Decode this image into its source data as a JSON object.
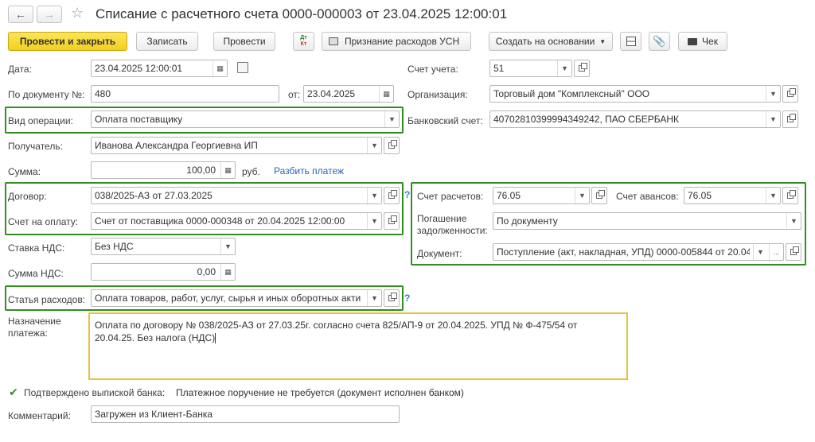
{
  "title": "Списание с расчетного счета 0000-000003 от 23.04.2025 12:00:01",
  "toolbar": {
    "post_close": "Провести и закрыть",
    "save": "Записать",
    "post": "Провести",
    "dtkt_top": "Дт",
    "dtkt_bottom": "Кт",
    "usn": "Признание расходов УСН",
    "create_based": "Создать на основании",
    "check": "Чек"
  },
  "fields": {
    "date_label": "Дата:",
    "date_value": "23.04.2025 12:00:01",
    "doc_no_label": "По документу №:",
    "doc_no_value": "480",
    "from_label": "от:",
    "from_value": "23.04.2025",
    "op_type_label": "Вид операции:",
    "op_type_value": "Оплата поставщику",
    "recipient_label": "Получатель:",
    "recipient_value": "Иванова Александра Георгиевна ИП",
    "sum_label": "Сумма:",
    "sum_value": "100,00",
    "currency": "руб.",
    "split_link": "Разбить платеж",
    "contract_label": "Договор:",
    "contract_value": "038/2025-АЗ от 27.03.2025",
    "invoice_label": "Счет на оплату:",
    "invoice_value": "Счет от поставщика 0000-000348 от 20.04.2025 12:00:00",
    "vat_rate_label": "Ставка НДС:",
    "vat_rate_value": "Без НДС",
    "vat_sum_label": "Сумма НДС:",
    "vat_sum_value": "0,00",
    "expense_label": "Статья расходов:",
    "expense_value": "Оплата товаров, работ, услуг, сырья и иных оборотных акти",
    "help": "?",
    "purpose_label_1": "Назначение",
    "purpose_label_2": "платежа:",
    "purpose_line1": "Оплата по договору № 038/2025-АЗ от 27.03.25г. согласно счета 825/АП-9 от 20.04.2025. УПД № Ф-475/54 от",
    "purpose_line2": "20.04.25. Без налога (НДС)",
    "confirmed_label": "Подтверждено выпиской банка:",
    "confirmed_value": "Платежное поручение не требуется (документ исполнен банком)",
    "comment_label": "Комментарий:",
    "comment_value": "Загружен из Клиент-Банка",
    "account_label": "Счет учета:",
    "account_value": "51",
    "org_label": "Организация:",
    "org_value": "Торговый дом \"Комплексный\" ООО",
    "bank_label": "Банковский счет:",
    "bank_value": "40702810399994349242, ПАО СБЕРБАНК",
    "settle_label": "Счет расчетов:",
    "settle_value": "76.05",
    "advance_label": "Счет авансов:",
    "advance_value": "76.05",
    "repay_label_1": "Погашение",
    "repay_label_2": "задолженности:",
    "repay_value": "По документу",
    "document_label": "Документ:",
    "document_value": "Поступление (акт, накладная, УПД) 0000-005844 от 20.04",
    "ellipsis": "..."
  },
  "colors": {
    "highlight_border": "#2f8f1f",
    "primary_button": "#f3cf1d",
    "purpose_border": "#e7c23a",
    "link": "#2a63b6"
  }
}
